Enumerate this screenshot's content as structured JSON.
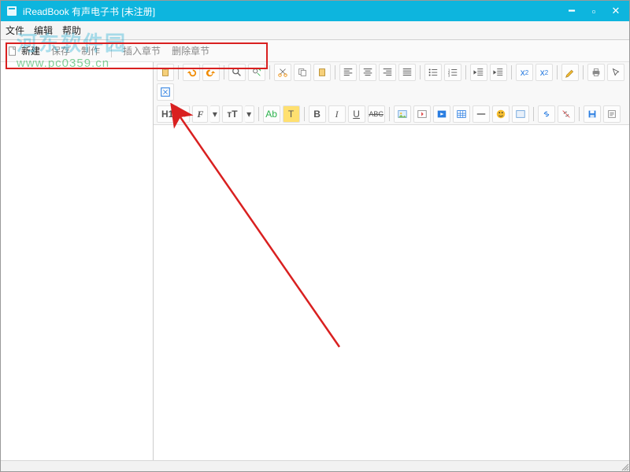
{
  "window": {
    "title": "iReadBook 有声电子书  [未注册]"
  },
  "menu": {
    "file": "文件",
    "edit": "编辑",
    "help": "帮助"
  },
  "watermark": {
    "brand": "河东软件园",
    "url": "www.pc0359.cn"
  },
  "toolbar": {
    "new": "新建",
    "save": "保存",
    "make": "制作",
    "insertChapter": "插入章节",
    "deleteChapter": "删除章节"
  },
  "editor": {
    "h1": "H1",
    "fontFamily": "F",
    "fontSize": "тT",
    "ab": "Ab",
    "t": "T",
    "bold": "B",
    "italic": "I",
    "underline": "U",
    "strike": "ABC"
  },
  "colors": {
    "accent": "#0db5de",
    "highlight": "#d92020"
  }
}
